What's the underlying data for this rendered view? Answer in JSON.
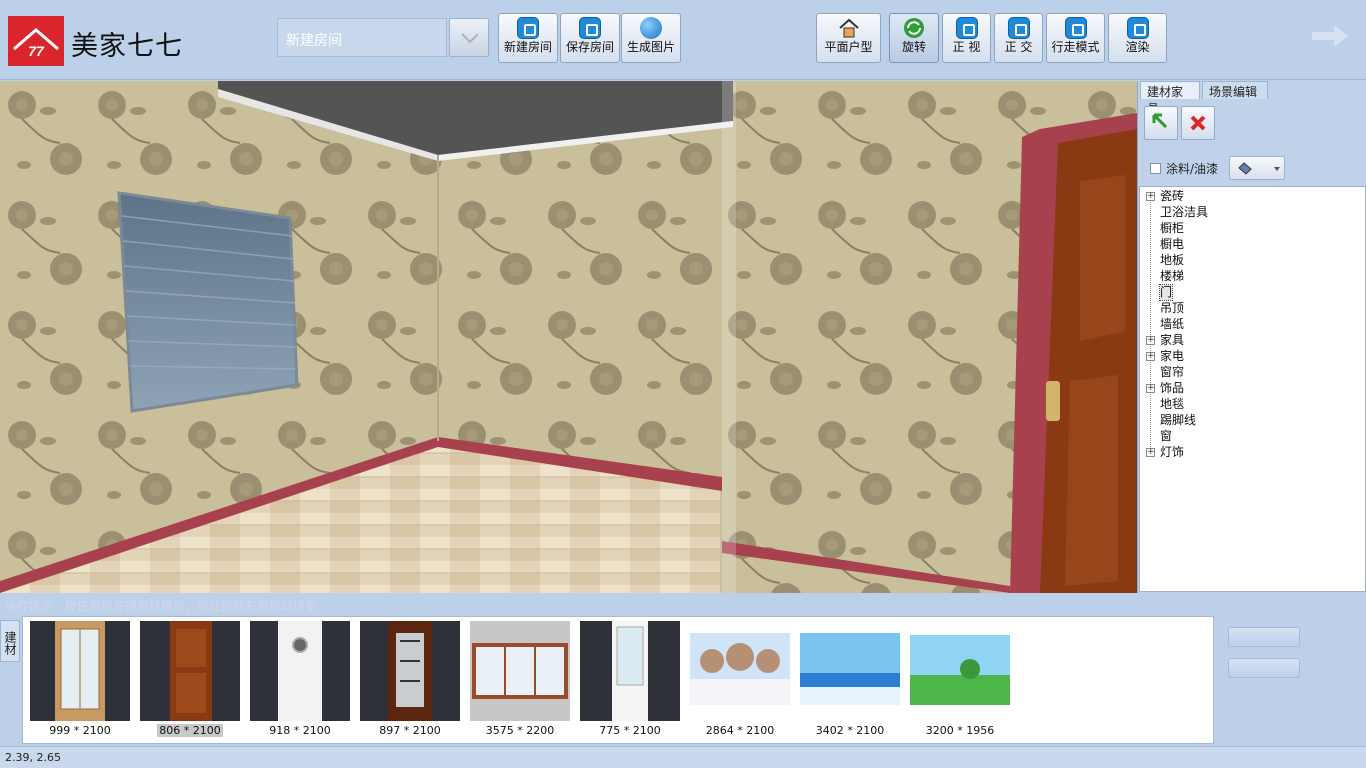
{
  "app": {
    "brand": "美家七七",
    "logo_text": "77"
  },
  "toolbar": {
    "room_name": "新建房间",
    "file_buttons": [
      {
        "label": "新建房间",
        "icon": "new-room-icon"
      },
      {
        "label": "保存房间",
        "icon": "save-room-icon"
      },
      {
        "label": "生成图片",
        "icon": "generate-image-icon"
      }
    ],
    "view_buttons": [
      {
        "label": "平面户型",
        "icon": "house-icon"
      },
      {
        "label": "旋转",
        "icon": "rotate-icon",
        "active": true
      },
      {
        "label": "正 视",
        "icon": "front-view-icon"
      },
      {
        "label": "正 交",
        "icon": "orthogonal-icon"
      },
      {
        "label": "行走模式",
        "icon": "walk-mode-icon"
      },
      {
        "label": "渲染",
        "icon": "render-icon"
      }
    ]
  },
  "right_panel": {
    "tabs": [
      {
        "label": "建材家具",
        "selected": true
      },
      {
        "label": "场景编辑",
        "selected": false
      }
    ],
    "paint_label": "涂料/油漆",
    "tree": [
      {
        "label": "瓷砖",
        "expandable": true
      },
      {
        "label": "卫浴洁具",
        "expandable": false
      },
      {
        "label": "橱柜",
        "expandable": false
      },
      {
        "label": "橱电",
        "expandable": false
      },
      {
        "label": "地板",
        "expandable": false
      },
      {
        "label": "楼梯",
        "expandable": false
      },
      {
        "label": "门",
        "expandable": false,
        "selected": true
      },
      {
        "label": "吊顶",
        "expandable": false
      },
      {
        "label": "墙纸",
        "expandable": false
      },
      {
        "label": "家具",
        "expandable": true
      },
      {
        "label": "家电",
        "expandable": true
      },
      {
        "label": "窗帘",
        "expandable": false
      },
      {
        "label": "饰品",
        "expandable": true
      },
      {
        "label": "地毯",
        "expandable": false
      },
      {
        "label": "踢脚线",
        "expandable": false
      },
      {
        "label": "窗",
        "expandable": false
      },
      {
        "label": "灯饰",
        "expandable": true
      }
    ]
  },
  "hint": "操作提示：按住鼠标左键旋转场景，按住鼠标右键移动场景",
  "bottom": {
    "side_tab": "建材",
    "thumbnails": [
      {
        "caption": "999 * 2100",
        "kind": "glass-door"
      },
      {
        "caption": "806 * 2100",
        "kind": "wood-door",
        "selected": true
      },
      {
        "caption": "918 * 2100",
        "kind": "white-door"
      },
      {
        "caption": "897 * 2100",
        "kind": "dark-glass-door"
      },
      {
        "caption": "3575 * 2200",
        "kind": "window"
      },
      {
        "caption": "775 * 2100",
        "kind": "white-glass-door"
      },
      {
        "caption": "2864 * 2100",
        "kind": "snow-mural"
      },
      {
        "caption": "3402 * 2100",
        "kind": "sea-mural"
      },
      {
        "caption": "3200 * 1956",
        "kind": "field-mural"
      }
    ]
  },
  "status": {
    "coords": "2.39,  2.65"
  },
  "colors": {
    "accent": "#d9252b",
    "skirting": "#a8414e",
    "door": "#8a3a12",
    "toolbar_bg": "#bcd0ea"
  }
}
